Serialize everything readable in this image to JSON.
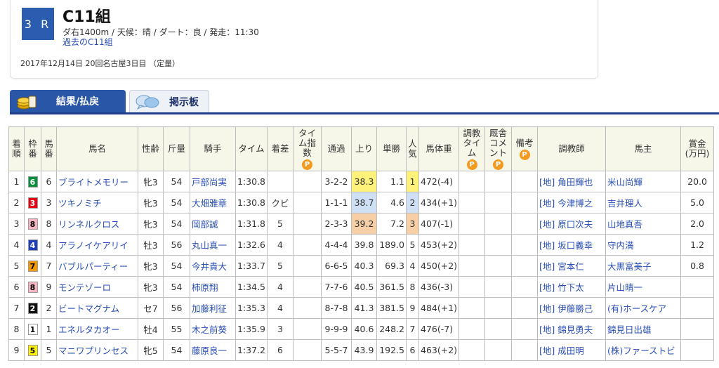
{
  "race": {
    "number": "3 R",
    "title": "C11組",
    "info": "ダ右1400m / 天候：晴 / ダート：良 / 発走：11:30",
    "past_link": "過去のC11組",
    "date": "2017年12月14日 20回名古屋3日目 （定量）"
  },
  "tabs": [
    {
      "label": "結果/払戻",
      "active": true,
      "icon": "coin-stack-icon"
    },
    {
      "label": "掲示板",
      "active": false,
      "icon": "speech-bubble-icon"
    }
  ],
  "headers": {
    "rank": "着順",
    "waku": "枠番",
    "num": "馬番",
    "name": "馬名",
    "sex_age": "性齢",
    "weight": "斤量",
    "jockey": "騎手",
    "time": "タイム",
    "margin": "着差",
    "time_index": "タイム指数",
    "passing": "通過",
    "last3f": "上り",
    "odds": "単勝",
    "pop": "人気",
    "horse_weight": "馬体重",
    "training_time": "調教タイム",
    "stable_comment": "厩舎コメント",
    "remarks": "備考",
    "trainer": "調教師",
    "owner": "馬主",
    "prize": "賞金(万円)",
    "premium_icon": "P"
  },
  "waku_colors": {
    "1": {
      "bg": "#ffffff",
      "fg": "#000000"
    },
    "2": {
      "bg": "#111111",
      "fg": "#ffffff"
    },
    "3": {
      "bg": "#e60012",
      "fg": "#ffffff"
    },
    "4": {
      "bg": "#1d3fbf",
      "fg": "#ffffff"
    },
    "5": {
      "bg": "#fff200",
      "fg": "#000000"
    },
    "6": {
      "bg": "#00913a",
      "fg": "#ffffff"
    },
    "7": {
      "bg": "#f39800",
      "fg": "#000000"
    },
    "8": {
      "bg": "#f7b2c4",
      "fg": "#000000"
    }
  },
  "rows": [
    {
      "rank": "1",
      "waku": "6",
      "num": "6",
      "name": "ブライトメモリー",
      "sex_age": "牝3",
      "weight": "54",
      "jockey": "戸部尚実",
      "time": "1:30.8",
      "margin": "",
      "passing": "3-2-2",
      "last3f": "38.3",
      "last3f_hl": "y",
      "odds": "1.1",
      "pop": "1",
      "pop_hl": "y",
      "horse_weight": "472(-4)",
      "trainer": "[地] 角田輝也",
      "owner": "米山尚輝",
      "prize": "20.0"
    },
    {
      "rank": "2",
      "waku": "3",
      "num": "3",
      "name": "ツキノミチ",
      "sex_age": "牝3",
      "weight": "54",
      "jockey": "大畑雅章",
      "time": "1:30.8",
      "margin": "クビ",
      "passing": "1-1-1",
      "last3f": "38.7",
      "last3f_hl": "b",
      "odds": "4.6",
      "pop": "2",
      "pop_hl": "b",
      "horse_weight": "434(+1)",
      "trainer": "[地] 今津博之",
      "owner": "吉井理人",
      "prize": "5.0"
    },
    {
      "rank": "3",
      "waku": "8",
      "num": "8",
      "name": "リンネルクロス",
      "sex_age": "牝3",
      "weight": "54",
      "jockey": "岡部誠",
      "time": "1:31.8",
      "margin": "5",
      "passing": "2-3-3",
      "last3f": "39.2",
      "last3f_hl": "o",
      "odds": "7.2",
      "pop": "3",
      "pop_hl": "o",
      "horse_weight": "407(-1)",
      "trainer": "[地] 原口次夫",
      "owner": "山地真吾",
      "prize": "2.0"
    },
    {
      "rank": "4",
      "waku": "4",
      "num": "4",
      "name": "アラノイケアリイ",
      "sex_age": "牡3",
      "weight": "56",
      "jockey": "丸山真一",
      "time": "1:32.6",
      "margin": "4",
      "passing": "4-4-4",
      "last3f": "39.8",
      "last3f_hl": "",
      "odds": "189.0",
      "pop": "5",
      "pop_hl": "",
      "horse_weight": "453(+2)",
      "trainer": "[地] 坂口義幸",
      "owner": "守内満",
      "prize": "1.2"
    },
    {
      "rank": "5",
      "waku": "7",
      "num": "7",
      "name": "バブルパーティー",
      "sex_age": "牝3",
      "weight": "54",
      "jockey": "今井貴大",
      "time": "1:33.7",
      "margin": "5",
      "passing": "6-6-5",
      "last3f": "40.3",
      "last3f_hl": "",
      "odds": "69.3",
      "pop": "4",
      "pop_hl": "",
      "horse_weight": "450(+2)",
      "trainer": "[地] 宮本仁",
      "owner": "大黒富美子",
      "prize": "0.8"
    },
    {
      "rank": "6",
      "waku": "8",
      "num": "9",
      "name": "モンテゾーロ",
      "sex_age": "牝3",
      "weight": "54",
      "jockey": "柿原翔",
      "time": "1:34.5",
      "margin": "4",
      "passing": "7-7-6",
      "last3f": "40.5",
      "last3f_hl": "",
      "odds": "361.5",
      "pop": "8",
      "pop_hl": "",
      "horse_weight": "436(-3)",
      "trainer": "[地] 竹下太",
      "owner": "片山晴一",
      "prize": ""
    },
    {
      "rank": "7",
      "waku": "2",
      "num": "2",
      "name": "ビートマグナム",
      "sex_age": "セ7",
      "weight": "56",
      "jockey": "加藤利征",
      "time": "1:35.3",
      "margin": "4",
      "passing": "8-7-8",
      "last3f": "41.3",
      "last3f_hl": "",
      "odds": "381.5",
      "pop": "9",
      "pop_hl": "",
      "horse_weight": "484(+1)",
      "trainer": "[地] 伊藤勝己",
      "owner": "(有)ホースケア",
      "prize": ""
    },
    {
      "rank": "8",
      "waku": "1",
      "num": "1",
      "name": "エネルタカオー",
      "sex_age": "牡4",
      "weight": "55",
      "jockey": "木之前葵",
      "time": "1:35.9",
      "margin": "3",
      "passing": "9-9-9",
      "last3f": "40.6",
      "last3f_hl": "",
      "odds": "248.2",
      "pop": "7",
      "pop_hl": "",
      "horse_weight": "476(-7)",
      "trainer": "[地] 錦見勇夫",
      "owner": "錦見日出雄",
      "prize": ""
    },
    {
      "rank": "9",
      "waku": "5",
      "num": "5",
      "name": "マニワプリンセス",
      "sex_age": "牝5",
      "weight": "54",
      "jockey": "藤原良一",
      "time": "1:37.2",
      "margin": "6",
      "passing": "5-5-7",
      "last3f": "43.9",
      "last3f_hl": "",
      "odds": "192.5",
      "pop": "6",
      "pop_hl": "",
      "horse_weight": "463(+2)",
      "trainer": "[地] 成田明",
      "owner": "(株)ファーストビ",
      "prize": ""
    }
  ]
}
